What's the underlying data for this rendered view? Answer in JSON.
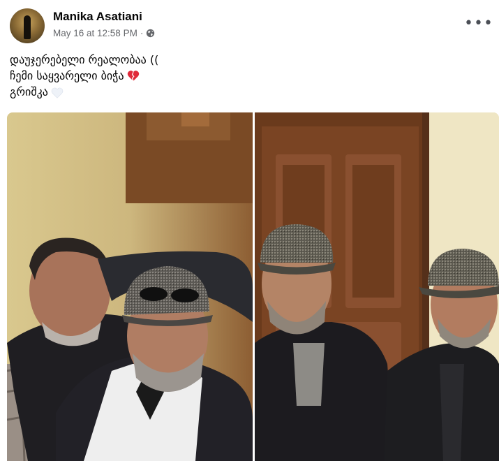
{
  "post": {
    "author": "Manika Asatiani",
    "date": "May 16 at 12:58 PM",
    "separator": "·",
    "audience_icon": "globe-icon",
    "more_label": "•••",
    "text_lines": [
      "დაუჯერებელი რეალობაა ((",
      "ჩემი საყვარელი ბიჭა",
      "გრიშკა"
    ],
    "emoji": {
      "line2": "heart-broken-icon",
      "line3": "heart-white-icon"
    }
  },
  "colors": {
    "meta_text": "#65676b",
    "broken_heart": "#e02a3a",
    "white_heart": "#e9eef7"
  }
}
